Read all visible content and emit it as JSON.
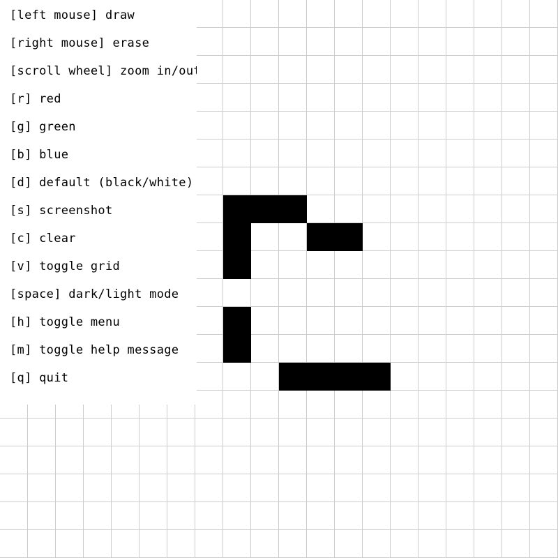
{
  "canvas": {
    "grid_visible": true,
    "mode": "light",
    "grid_color": "#cccccc",
    "background_color": "#ffffff",
    "pixel_color": "#000000",
    "filled_cells": [
      [
        8,
        7
      ],
      [
        9,
        7
      ],
      [
        10,
        7
      ],
      [
        8,
        8
      ],
      [
        11,
        8
      ],
      [
        12,
        8
      ],
      [
        8,
        9
      ],
      [
        8,
        11
      ],
      [
        8,
        12
      ],
      [
        10,
        13
      ],
      [
        11,
        13
      ],
      [
        12,
        13
      ],
      [
        13,
        13
      ]
    ]
  },
  "help_menu": {
    "items": [
      "[left mouse] draw",
      "[right mouse] erase",
      "[scroll wheel] zoom in/out",
      "[r] red",
      "[g] green",
      "[b] blue",
      "[d] default (black/white)",
      "[s] screenshot",
      "[c] clear",
      "[v] toggle grid",
      "[space] dark/light mode",
      "[h] toggle menu",
      "[m] toggle help message",
      "[q] quit"
    ]
  }
}
